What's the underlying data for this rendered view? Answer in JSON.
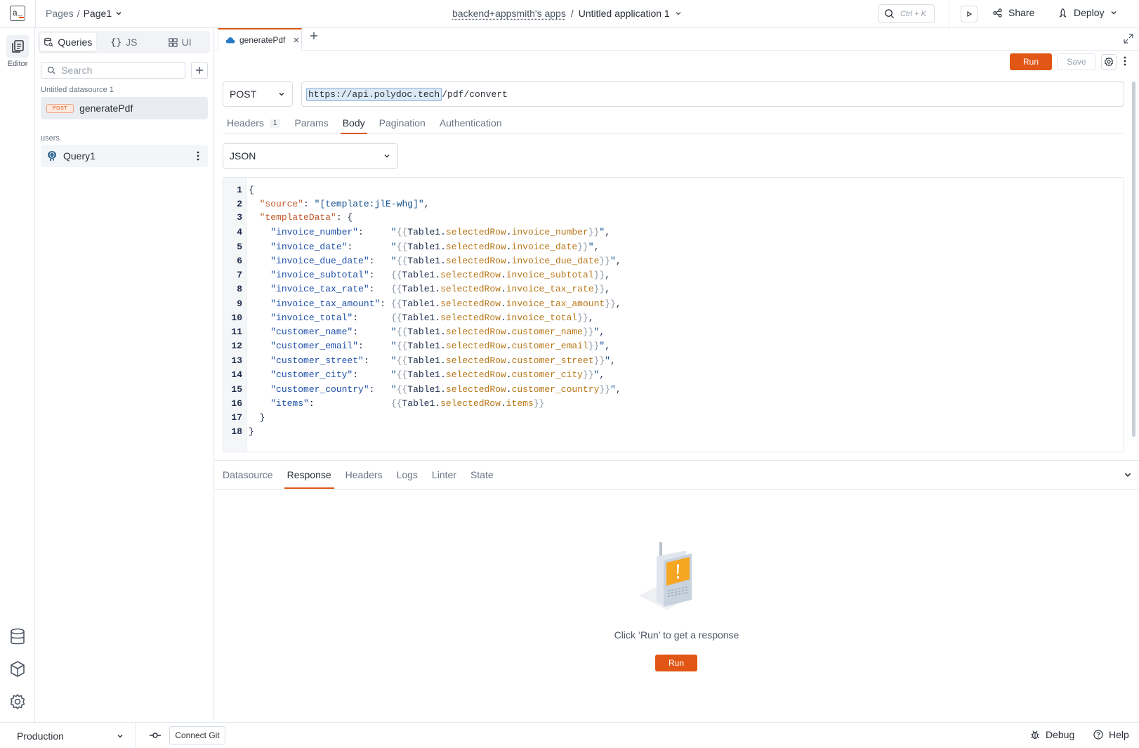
{
  "topbar": {
    "logo_text": "a_",
    "breadcrumb": {
      "root": "Pages",
      "separator": "/",
      "current": "Page1"
    },
    "workspace": "backend+appsmith's apps",
    "title_separator": "/",
    "app_name": "Untitled application 1",
    "search_shortcut": "Ctrl + K",
    "share_label": "Share",
    "deploy_label": "Deploy"
  },
  "rail": {
    "editor_label": "Editor"
  },
  "sidebar": {
    "tabs": [
      {
        "label": "Queries",
        "active": true
      },
      {
        "label": "JS",
        "active": false
      },
      {
        "label": "UI",
        "active": false
      }
    ],
    "search_placeholder": "Search",
    "groups": [
      {
        "label": "Untitled datasource 1",
        "items": [
          {
            "badge": "POST",
            "label": "generatePdf",
            "selected": true
          }
        ]
      },
      {
        "label": "users",
        "items": [
          {
            "label": "Query1",
            "selected": false
          }
        ]
      }
    ]
  },
  "editor": {
    "tab_label": "generatePdf",
    "run_label": "Run",
    "save_label": "Save",
    "method": "POST",
    "url_base": "https://api.polydoc.tech",
    "url_path": "/pdf/convert",
    "request_tabs": [
      {
        "label": "Headers",
        "count": "1",
        "active": false
      },
      {
        "label": "Params",
        "active": false
      },
      {
        "label": "Body",
        "active": true
      },
      {
        "label": "Pagination",
        "active": false
      },
      {
        "label": "Authentication",
        "active": false
      }
    ],
    "body_type": "JSON",
    "code_lines": [
      {
        "n": "1"
      },
      {
        "n": "2"
      },
      {
        "n": "3"
      },
      {
        "n": "4"
      },
      {
        "n": "5"
      },
      {
        "n": "6"
      },
      {
        "n": "7"
      },
      {
        "n": "8"
      },
      {
        "n": "9"
      },
      {
        "n": "10"
      },
      {
        "n": "11"
      },
      {
        "n": "12"
      },
      {
        "n": "13"
      },
      {
        "n": "14"
      },
      {
        "n": "15"
      },
      {
        "n": "16"
      },
      {
        "n": "17"
      },
      {
        "n": "18"
      }
    ],
    "code": {
      "source_key": "\"source\"",
      "source_val": "\"[template:jlE-whg]\"",
      "templateData_key": "\"templateData\"",
      "fields": [
        {
          "key": "\"invoice_number\"",
          "quoted": true,
          "prop": "invoice_number"
        },
        {
          "key": "\"invoice_date\"",
          "quoted": true,
          "prop": "invoice_date"
        },
        {
          "key": "\"invoice_due_date\"",
          "quoted": true,
          "prop": "invoice_due_date"
        },
        {
          "key": "\"invoice_subtotal\"",
          "quoted": false,
          "prop": "invoice_subtotal"
        },
        {
          "key": "\"invoice_tax_rate\"",
          "quoted": false,
          "prop": "invoice_tax_rate"
        },
        {
          "key": "\"invoice_tax_amount\"",
          "quoted": false,
          "prop": "invoice_tax_amount"
        },
        {
          "key": "\"invoice_total\"",
          "quoted": false,
          "prop": "invoice_total"
        },
        {
          "key": "\"customer_name\"",
          "quoted": true,
          "prop": "customer_name"
        },
        {
          "key": "\"customer_email\"",
          "quoted": true,
          "prop": "customer_email"
        },
        {
          "key": "\"customer_street\"",
          "quoted": true,
          "prop": "customer_street"
        },
        {
          "key": "\"customer_city\"",
          "quoted": true,
          "prop": "customer_city"
        },
        {
          "key": "\"customer_country\"",
          "quoted": true,
          "prop": "customer_country"
        },
        {
          "key": "\"items\"",
          "quoted": false,
          "prop": "items"
        }
      ],
      "widget": "Table1",
      "accessor": "selectedRow"
    }
  },
  "response_panel": {
    "tabs": [
      {
        "label": "Datasource",
        "active": false
      },
      {
        "label": "Response",
        "active": true
      },
      {
        "label": "Headers",
        "active": false
      },
      {
        "label": "Logs",
        "active": false
      },
      {
        "label": "Linter",
        "active": false
      },
      {
        "label": "State",
        "active": false
      }
    ],
    "empty_message": "Click ‘Run’ to get a response",
    "run_label": "Run"
  },
  "statusbar": {
    "environment": "Production",
    "connect_git_label": "Connect Git",
    "debug_label": "Debug",
    "help_label": "Help"
  },
  "colors": {
    "accent": "#e15615",
    "text": "#2b313a",
    "muted": "#6a7585",
    "border": "#e3e8ef"
  }
}
